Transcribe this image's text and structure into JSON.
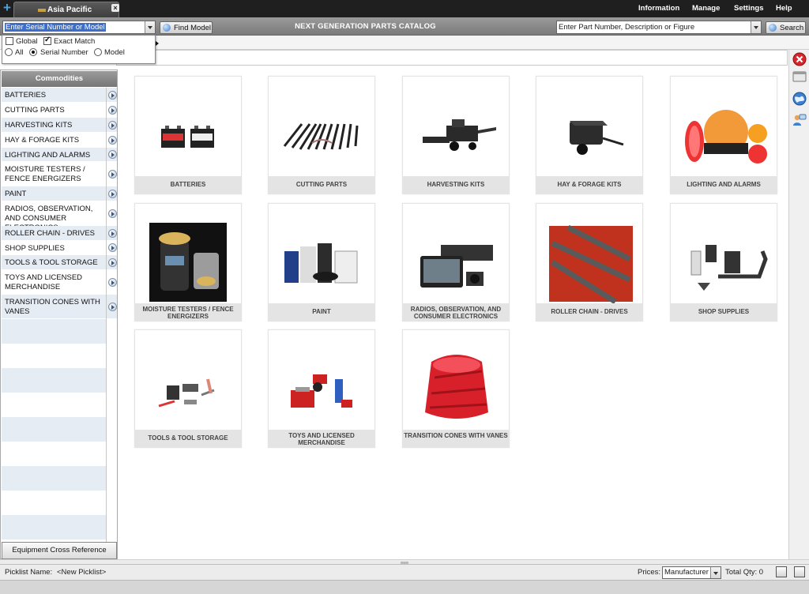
{
  "window": {
    "tab_label": "Asia Pacific",
    "nav": [
      "Information",
      "Manage",
      "Settings",
      "Help"
    ]
  },
  "search": {
    "serial_value": "Enter Serial Number or Model",
    "find_model_label": "Find Model",
    "catalog_title": "NEXT GENERATION PARTS CATALOG",
    "part_value": "Enter Part Number, Description or Figure",
    "search_label": "Search"
  },
  "options": {
    "global_label": "Global",
    "global_checked": false,
    "exact_match_label": "Exact Match",
    "exact_match_checked": true,
    "radios": [
      "All",
      "Serial Number",
      "Model"
    ],
    "selected_radio": "Serial Number"
  },
  "commodities": {
    "header": "Commodities",
    "items": [
      "BATTERIES",
      "CUTTING PARTS",
      "HARVESTING KITS",
      "HAY & FORAGE KITS",
      "LIGHTING AND ALARMS",
      "MOISTURE TESTERS / FENCE ENERGIZERS",
      "PAINT",
      "RADIOS, OBSERVATION, AND CONSUMER ELECTRONICS",
      "ROLLER CHAIN - DRIVES",
      "SHOP SUPPLIES",
      "TOOLS & TOOL STORAGE",
      "TOYS AND LICENSED MERCHANDISE",
      "TRANSITION CONES WITH VANES"
    ],
    "footer_button": "Equipment Cross Reference"
  },
  "tiles": [
    {
      "label": "BATTERIES",
      "icon": "battery-icon"
    },
    {
      "label": "CUTTING PARTS",
      "icon": "cutting-parts-icon"
    },
    {
      "label": "HARVESTING KITS",
      "icon": "combine-harvester-icon"
    },
    {
      "label": "HAY & FORAGE KITS",
      "icon": "baler-icon"
    },
    {
      "label": "LIGHTING AND ALARMS",
      "icon": "warning-lights-icon"
    },
    {
      "label": "MOISTURE TESTERS / FENCE ENERGIZERS",
      "icon": "moisture-tester-icon"
    },
    {
      "label": "PAINT",
      "icon": "paint-cans-icon"
    },
    {
      "label": "RADIOS, OBSERVATION, AND CONSUMER ELECTRONICS",
      "icon": "monitor-radio-icon"
    },
    {
      "label": "ROLLER CHAIN - DRIVES",
      "icon": "roller-chain-icon"
    },
    {
      "label": "SHOP SUPPLIES",
      "icon": "shop-supplies-icon"
    },
    {
      "label": "TOOLS & TOOL STORAGE",
      "icon": "tools-icon"
    },
    {
      "label": "TOYS AND LICENSED MERCHANDISE",
      "icon": "toy-tractor-icon"
    },
    {
      "label": "TRANSITION CONES WITH VANES",
      "icon": "transition-cone-icon"
    }
  ],
  "right_icons": [
    "close-icon",
    "window-icon",
    "globe-icon",
    "user-chat-icon"
  ],
  "status": {
    "picklist_label": "Picklist Name:",
    "picklist_value": "<New Picklist>",
    "prices_label": "Prices:",
    "prices_value": "Manufacturer",
    "total_qty": "Total Qty: 0"
  },
  "colors": {
    "topbar": "#1f1f1f",
    "accent_blue": "#3d6fc9",
    "tile_caption": "#e4e4e4",
    "close_red": "#d9262b"
  }
}
